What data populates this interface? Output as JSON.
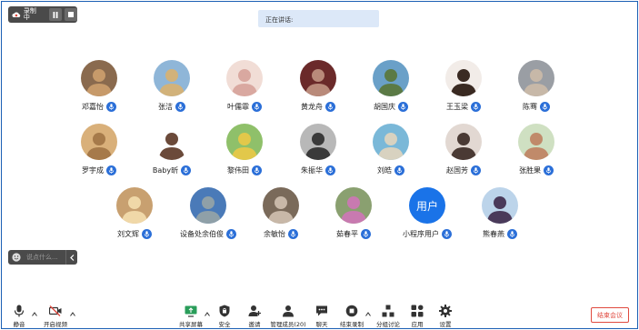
{
  "recording": {
    "label": "录制中"
  },
  "speaking": {
    "label": "正在讲话:"
  },
  "participants": [
    {
      "name": "邓嘉怡",
      "bg": "#8a6a4e",
      "fg": "#c79a6a"
    },
    {
      "name": "张洁",
      "bg": "#8fb6d8",
      "fg": "#d2b27a"
    },
    {
      "name": "叶儒霏",
      "bg": "#f1ddd6",
      "fg": "#d9a8a0"
    },
    {
      "name": "黄龙舟",
      "bg": "#6b2a2a",
      "fg": "#b98a7a"
    },
    {
      "name": "胡国庆",
      "bg": "#6aa0c8",
      "fg": "#5b7a45"
    },
    {
      "name": "王玉梁",
      "bg": "#f2ece8",
      "fg": "#3a2a22"
    },
    {
      "name": "陈骞",
      "bg": "#9a9ea4",
      "fg": "#c7b8a8"
    },
    {
      "name": "罗宇成",
      "bg": "#d9b07a",
      "fg": "#a67a4a"
    },
    {
      "name": "Baby昕",
      "bg": "#ffffff",
      "fg": "#6b4a3a"
    },
    {
      "name": "黎伟田",
      "bg": "#8fc06a",
      "fg": "#e2c84a"
    },
    {
      "name": "朱振华",
      "bg": "#b8b8b8",
      "fg": "#3a3a3a"
    },
    {
      "name": "刘皓",
      "bg": "#7ab8d8",
      "fg": "#d8d2c0"
    },
    {
      "name": "赵国芳",
      "bg": "#e2d8d2",
      "fg": "#4a3a34"
    },
    {
      "name": "张胜果",
      "bg": "#cfe0c2",
      "fg": "#c08a6a"
    },
    {
      "name": "刘文辉",
      "bg": "#c8a070",
      "fg": "#f0d8a8"
    },
    {
      "name": "设备处余伯俊",
      "bg": "#4a7ab8",
      "fg": "#8fa0a8"
    },
    {
      "name": "余敏怡",
      "bg": "#7a6a5a",
      "fg": "#c8b8a8"
    },
    {
      "name": "茹春平",
      "bg": "#8aa070",
      "fg": "#c87ab0"
    },
    {
      "name": "小程序用户",
      "bg": "#1a73e8",
      "fg": "#ffffff",
      "text": "用户"
    },
    {
      "name": "熊春燕",
      "bg": "#bcd4ea",
      "fg": "#4a3a5a"
    }
  ],
  "chat": {
    "placeholder": "说点什么..."
  },
  "toolbar": {
    "mute": "静音",
    "video": "开启视频",
    "share": "共享屏幕",
    "security": "安全",
    "invite": "邀请",
    "members": "管理成员(20)",
    "chat": "聊天",
    "record": "结束录制",
    "breakout": "分组讨论",
    "apps": "应用",
    "settings": "设置",
    "end": "结束会议"
  },
  "colors": {
    "accent": "#2b6fd8",
    "danger": "#e04a3f",
    "share_green": "#2a9d5a"
  }
}
